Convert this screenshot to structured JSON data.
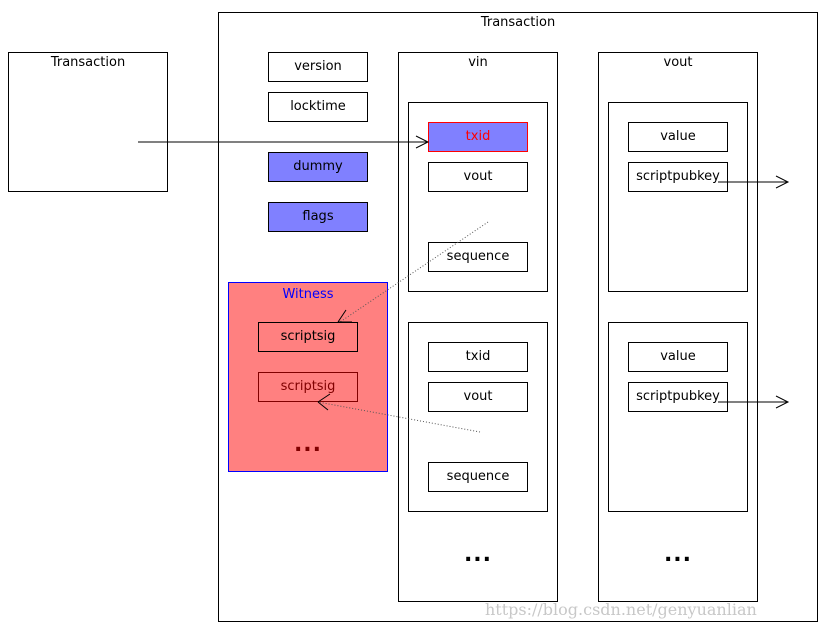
{
  "left_tx": {
    "title": "Transaction"
  },
  "main_tx": {
    "title": "Transaction",
    "version": "version",
    "locktime": "locktime",
    "dummy": "dummy",
    "flags": "flags"
  },
  "witness": {
    "title": "Witness",
    "items": [
      "scriptsig",
      "scriptsig"
    ],
    "more": "..."
  },
  "vin": {
    "title": "vin",
    "inputs": [
      {
        "txid": "txid",
        "vout": "vout",
        "sequence": "sequence"
      },
      {
        "txid": "txid",
        "vout": "vout",
        "sequence": "sequence"
      }
    ],
    "more": "..."
  },
  "vout": {
    "title": "vout",
    "outputs": [
      {
        "value": "value",
        "scriptpubkey": "scriptpubkey"
      },
      {
        "value": "value",
        "scriptpubkey": "scriptpubkey"
      }
    ],
    "more": "..."
  },
  "colors": {
    "highlight_blue": "#8080ff",
    "witness_fill": "#ff8080",
    "witness_border": "#0000ff",
    "txid_text": "#ff0000",
    "second_scriptsig": "#800000"
  },
  "watermark": "https://blog.csdn.net/genyuanlian"
}
